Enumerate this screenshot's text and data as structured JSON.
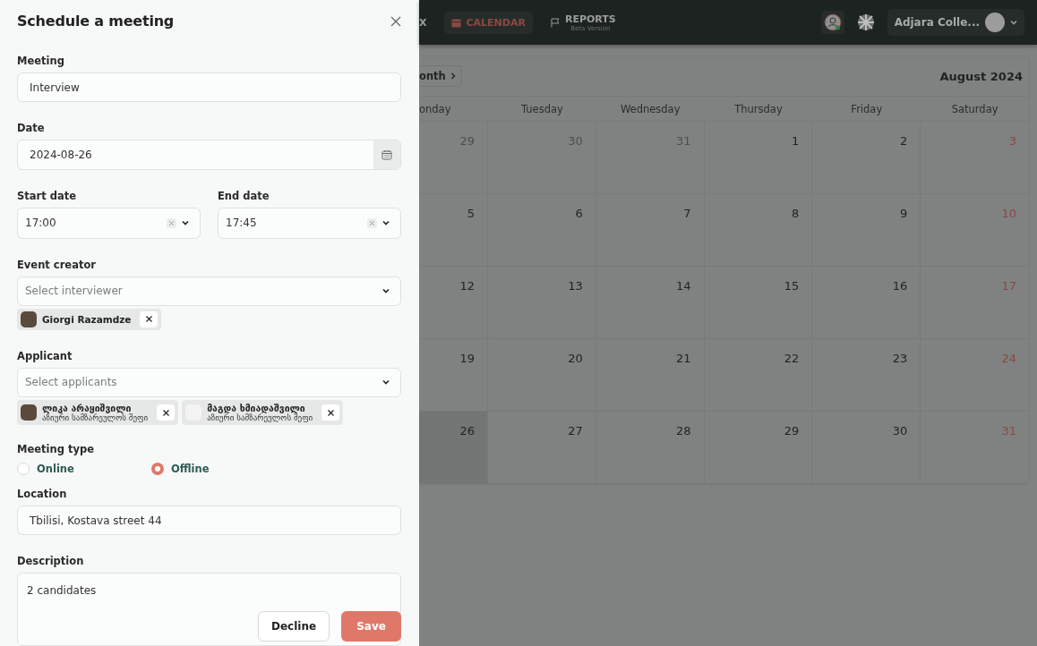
{
  "dialog": {
    "title": "Schedule a meeting",
    "meeting": {
      "label": "Meeting",
      "value": "Interview"
    },
    "date": {
      "label": "Date",
      "value": "2024-08-26"
    },
    "start": {
      "label": "Start date",
      "value": "17:00"
    },
    "end": {
      "label": "End date",
      "value": "17:45"
    },
    "creator": {
      "label": "Event creator",
      "placeholder": "Select interviewer",
      "chips": [
        {
          "name": "Giorgi Razamdze",
          "photo": true
        }
      ]
    },
    "applicant": {
      "label": "Applicant",
      "placeholder": "Select applicants",
      "chips": [
        {
          "name": "ლიკა არაყიშვილი",
          "role": "აზიური სამზარეულოს შეფი",
          "photo": true
        },
        {
          "name": "მაგდა ხმიადაშვილი",
          "role": "აზიური სამზარეულოს შეფი",
          "photo": false
        }
      ]
    },
    "meeting_type": {
      "label": "Meeting type",
      "options": [
        {
          "label": "Online",
          "selected": false
        },
        {
          "label": "Offline",
          "selected": true
        }
      ]
    },
    "location": {
      "label": "Location",
      "value": "Tbilisi, Kostava street 44"
    },
    "description": {
      "label": "Description",
      "value": "2 candidates"
    },
    "buttons": [
      {
        "label": "Decline",
        "kind": "secondary"
      },
      {
        "label": "Save",
        "kind": "primary"
      }
    ]
  },
  "top_bar": {
    "nav": [
      {
        "label": "X",
        "selected": false
      },
      {
        "label": "CALENDAR",
        "selected": true
      },
      {
        "label": "REPORTS",
        "sublabel": "Beta Version",
        "selected": false
      }
    ],
    "account": "Adjara Colle..."
  },
  "calendar": {
    "view_button": "onth",
    "title": "August 2024",
    "columns": [
      "onday",
      "Tuesday",
      "Wednesday",
      "Thursday",
      "Friday",
      "Saturday"
    ],
    "weeks": [
      [
        {
          "day": "29",
          "kind": "other",
          "selected": false
        },
        {
          "day": "30",
          "kind": "other",
          "selected": false
        },
        {
          "day": "31",
          "kind": "other",
          "selected": false
        },
        {
          "day": "1",
          "kind": "day",
          "selected": false
        },
        {
          "day": "2",
          "kind": "day",
          "selected": false
        },
        {
          "day": "3",
          "kind": "weekend",
          "selected": false
        }
      ],
      [
        {
          "day": "5",
          "kind": "day",
          "selected": false
        },
        {
          "day": "6",
          "kind": "day",
          "selected": false
        },
        {
          "day": "7",
          "kind": "day",
          "selected": false
        },
        {
          "day": "8",
          "kind": "day",
          "selected": false
        },
        {
          "day": "9",
          "kind": "day",
          "selected": false
        },
        {
          "day": "10",
          "kind": "weekend",
          "selected": false
        }
      ],
      [
        {
          "day": "12",
          "kind": "day",
          "selected": false
        },
        {
          "day": "13",
          "kind": "day",
          "selected": false
        },
        {
          "day": "14",
          "kind": "day",
          "selected": false
        },
        {
          "day": "15",
          "kind": "day",
          "selected": false
        },
        {
          "day": "16",
          "kind": "day",
          "selected": false
        },
        {
          "day": "17",
          "kind": "weekend",
          "selected": false
        }
      ],
      [
        {
          "day": "19",
          "kind": "day",
          "selected": false
        },
        {
          "day": "20",
          "kind": "day",
          "selected": false
        },
        {
          "day": "21",
          "kind": "day",
          "selected": false
        },
        {
          "day": "22",
          "kind": "day",
          "selected": false
        },
        {
          "day": "23",
          "kind": "day",
          "selected": false
        },
        {
          "day": "24",
          "kind": "weekend",
          "selected": false
        }
      ],
      [
        {
          "day": "26",
          "kind": "day",
          "selected": true
        },
        {
          "day": "27",
          "kind": "day",
          "selected": false
        },
        {
          "day": "28",
          "kind": "day",
          "selected": false
        },
        {
          "day": "29",
          "kind": "day",
          "selected": false
        },
        {
          "day": "30",
          "kind": "day",
          "selected": false
        },
        {
          "day": "31",
          "kind": "weekend",
          "selected": false
        }
      ]
    ]
  }
}
